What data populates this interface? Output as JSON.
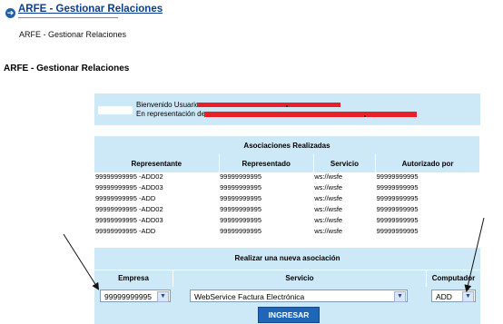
{
  "header": {
    "link_text": "ARFE - Gestionar Relaciones",
    "subtitle": "ARFE - Gestionar Relaciones"
  },
  "page_title": "ARFE - Gestionar Relaciones",
  "welcome": {
    "line1": "Bienvenido Usuario",
    "line2": "En representación de"
  },
  "associations": {
    "title": "Asociaciones Realizadas",
    "columns": [
      "Representante",
      "Representado",
      "Servicio",
      "Autorizado por"
    ],
    "rows": [
      [
        "99999999995 -ADD02",
        "99999999995",
        "ws://wsfe",
        "99999999995"
      ],
      [
        "99999999995 -ADD03",
        "99999999995",
        "ws://wsfe",
        "99999999995"
      ],
      [
        "99999999995 -ADD",
        "99999999995",
        "ws://wsfe",
        "99999999995"
      ],
      [
        "99999999995 -ADD02",
        "99999999995",
        "ws://wsfe",
        "99999999995"
      ],
      [
        "99999999995 -ADD03",
        "99999999995",
        "ws://wsfe",
        "99999999995"
      ],
      [
        "99999999995 -ADD",
        "99999999995",
        "ws://wsfe",
        "99999999995"
      ]
    ]
  },
  "new_association": {
    "title": "Realizar una nueva asociación",
    "empresa_label": "Empresa",
    "servicio_label": "Servicio",
    "computador_label": "Computador",
    "empresa_value": "99999999995",
    "servicio_value": "WebService Factura Electrónica",
    "computador_value": "ADD",
    "submit_label": "INGRESAR"
  },
  "colors": {
    "panel": "#cde8f7",
    "redaction": "#e8202a",
    "button": "#1f66b8",
    "link": "#0b3d91"
  }
}
